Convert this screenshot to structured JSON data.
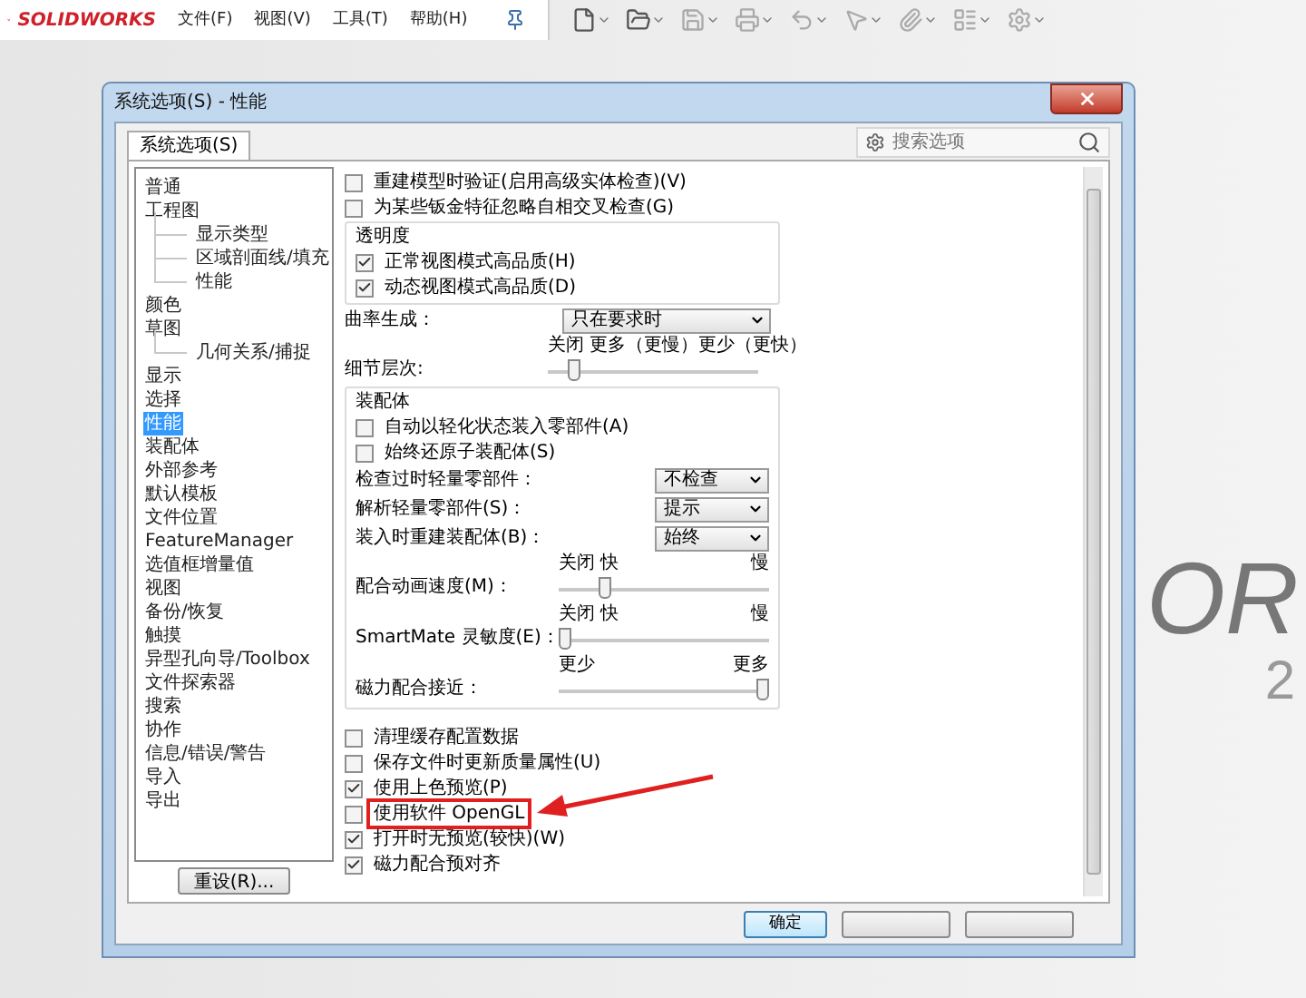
{
  "app": {
    "logo": "SOLIDWORKS",
    "menu": [
      "文件(F)",
      "视图(V)",
      "工具(T)",
      "帮助(H)"
    ],
    "background_text": [
      "OR",
      "2"
    ]
  },
  "dialog": {
    "title": "系统选项(S) - 性能",
    "tabs": [
      {
        "label": "系统选项(S)",
        "selected": true
      }
    ],
    "search": {
      "placeholder": "搜索选项"
    },
    "tree": [
      {
        "label": "普通",
        "selected": false
      },
      {
        "label": "工程图",
        "selected": false,
        "children": [
          {
            "label": "显示类型",
            "selected": false
          },
          {
            "label": "区域剖面线/填充",
            "selected": false
          },
          {
            "label": "性能",
            "selected": false
          }
        ]
      },
      {
        "label": "颜色",
        "selected": false
      },
      {
        "label": "草图",
        "selected": false,
        "children": [
          {
            "label": "几何关系/捕捉",
            "selected": false
          }
        ]
      },
      {
        "label": "显示",
        "selected": false
      },
      {
        "label": "选择",
        "selected": false
      },
      {
        "label": "性能",
        "selected": true
      },
      {
        "label": "装配体",
        "selected": false
      },
      {
        "label": "外部参考",
        "selected": false
      },
      {
        "label": "默认模板",
        "selected": false
      },
      {
        "label": "文件位置",
        "selected": false
      },
      {
        "label": "FeatureManager",
        "selected": false
      },
      {
        "label": "选值框增量值",
        "selected": false
      },
      {
        "label": "视图",
        "selected": false
      },
      {
        "label": "备份/恢复",
        "selected": false
      },
      {
        "label": "触摸",
        "selected": false
      },
      {
        "label": "异型孔向导/Toolbox",
        "selected": false
      },
      {
        "label": "文件探索器",
        "selected": false
      },
      {
        "label": "搜索",
        "selected": false
      },
      {
        "label": "协作",
        "selected": false
      },
      {
        "label": "信息/错误/警告",
        "selected": false
      },
      {
        "label": "导入",
        "selected": false
      },
      {
        "label": "导出",
        "selected": false
      }
    ],
    "reset_button": "重设(R)...",
    "options": [
      {
        "kind": "checkbox",
        "label": "重建模型时验证(启用高级实体检查)(V)",
        "checked": false
      },
      {
        "kind": "checkbox",
        "label": "为某些钣金特征忽略自相交叉检查(G)",
        "checked": false
      },
      {
        "kind": "group",
        "title": "透明度",
        "items": [
          {
            "kind": "checkbox",
            "label": "正常视图模式高品质(H)",
            "checked": true
          },
          {
            "kind": "checkbox",
            "label": "动态视图模式高品质(D)",
            "checked": true
          }
        ]
      },
      {
        "kind": "dropdown",
        "label": "曲率生成：",
        "value": "只在要求时"
      },
      {
        "kind": "slider",
        "label": "细节层次:",
        "left": "关闭 更多（更慢）",
        "right": "更少（更快）",
        "level": 0.1
      },
      {
        "kind": "group",
        "title": "装配体",
        "items": [
          {
            "kind": "checkbox",
            "label": "自动以轻化状态装入零部件(A)",
            "checked": false
          },
          {
            "kind": "checkbox",
            "label": "始终还原子装配体(S)",
            "checked": false
          },
          {
            "kind": "dropdown",
            "label": "检查过时轻量零部件：",
            "value": "不检查"
          },
          {
            "kind": "dropdown",
            "label": "解析轻量零部件(S)：",
            "value": "提示"
          },
          {
            "kind": "dropdown",
            "label": "装入时重建装配体(B)：",
            "value": "始终"
          },
          {
            "kind": "slider",
            "label": "配合动画速度(M)：",
            "left": "关闭 快",
            "right": "慢",
            "level": 0.2
          },
          {
            "kind": "slider",
            "label": "SmartMate 灵敏度(E)：",
            "left": "关闭 快",
            "right": "慢",
            "level": 0
          },
          {
            "kind": "slider",
            "label": "磁力配合接近：",
            "left": "更少",
            "right": "更多",
            "level": 1
          }
        ]
      },
      {
        "kind": "checkbox",
        "label": "清理缓存配置数据",
        "checked": false
      },
      {
        "kind": "checkbox",
        "label": "保存文件时更新质量属性(U)",
        "checked": false
      },
      {
        "kind": "checkbox",
        "label": "使用上色预览(P)",
        "checked": true
      },
      {
        "kind": "checkbox",
        "label": "使用软件 OpenGL",
        "checked": false,
        "highlighted": true
      },
      {
        "kind": "checkbox",
        "label": "打开时无预览(较快)(W)",
        "checked": true
      },
      {
        "kind": "checkbox",
        "label": "磁力配合预对齐",
        "checked": true
      }
    ],
    "buttons": [
      "确定"
    ]
  }
}
